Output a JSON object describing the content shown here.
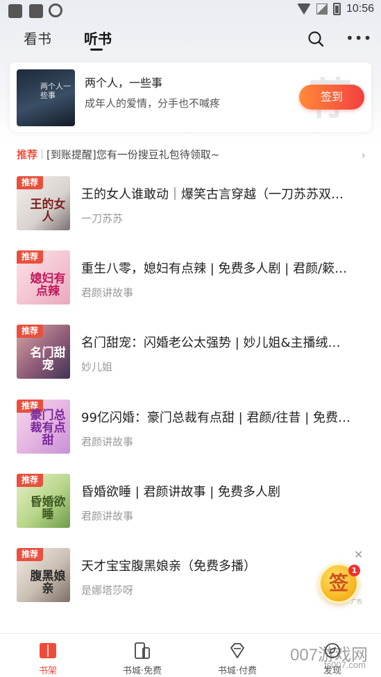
{
  "status_bar": {
    "time": "10:56"
  },
  "tabs": {
    "read": "看书",
    "listen": "听书"
  },
  "banner": {
    "cover_text": "两个人一些事",
    "title": "两个人，一些事",
    "subtitle": "成年人的爱情，分手也不喊疼",
    "checkin_label": "签到",
    "watermark": "荐"
  },
  "notice": {
    "tag": "推荐",
    "text": "[到账提醒]您有一份搜豆礼包待领取~"
  },
  "books": [
    {
      "badge": "推荐",
      "cover_text": "王的女人",
      "title": "王的女人谁敢动｜爆笑古言穿越（一刀苏苏双…",
      "author": "一刀苏苏"
    },
    {
      "badge": "推荐",
      "cover_text": "媳妇有点辣",
      "title": "重生八零，媳妇有点辣 | 免费多人剧 | 君颜/簌…",
      "author": "君颜讲故事"
    },
    {
      "badge": "推荐",
      "cover_text": "名门甜宠",
      "title": "名门甜宠：闪婚老公太强势 | 妙儿姐&主播绒…",
      "author": "妙儿姐"
    },
    {
      "badge": "推荐",
      "cover_text": "豪门总裁有点甜",
      "title": "99亿闪婚：豪门总裁有点甜 | 君颜/往昔 | 免费…",
      "author": "君颜讲故事"
    },
    {
      "badge": "推荐",
      "cover_text": "昏婚欲睡",
      "title": "昏婚欲睡 | 君颜讲故事 | 免费多人剧",
      "author": "君颜讲故事"
    },
    {
      "badge": "推荐",
      "cover_text": "腹黑娘亲",
      "title": "天才宝宝腹黑娘亲（免费多播）",
      "author": "是娜塔莎呀"
    }
  ],
  "float": {
    "label": "签",
    "count": "1",
    "ad": "广告"
  },
  "bottom_nav": [
    {
      "label": "书架"
    },
    {
      "label": "书城·免费"
    },
    {
      "label": "书城·付费"
    },
    {
      "label": "发现"
    }
  ],
  "watermark": {
    "main": "007游戏网",
    "sub": "ts007.com"
  },
  "colors": {
    "accent": "#ee4a3c",
    "checkin_start": "#ff8a3a",
    "checkin_end": "#f33f3f"
  }
}
